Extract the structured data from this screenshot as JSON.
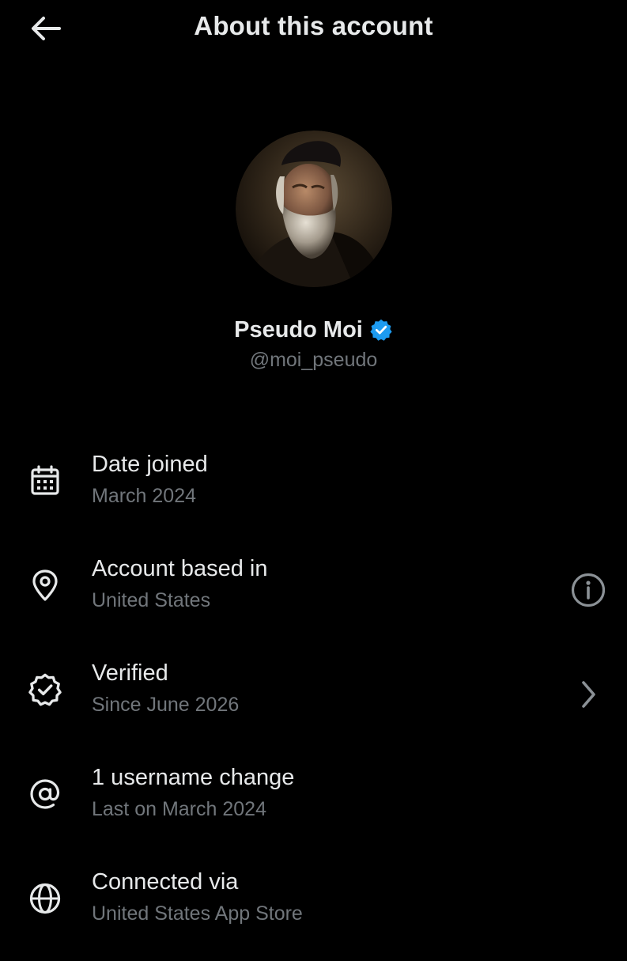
{
  "header": {
    "back_icon": "arrow-left-icon",
    "title": "About this account"
  },
  "profile": {
    "avatar": "portrait-avatar",
    "display_name": "Pseudo Moi",
    "verified_icon": "verified-badge-icon",
    "handle": "@moi_pseudo"
  },
  "rows": [
    {
      "icon": "calendar-icon",
      "label": "Date joined",
      "value": "March 2024"
    },
    {
      "icon": "location-pin-icon",
      "label": "Account based in",
      "value": "United States",
      "action_icon": "info-icon"
    },
    {
      "icon": "verified-check-icon",
      "label": "Verified",
      "value": "Since June 2026",
      "action_icon": "chevron-right-icon"
    },
    {
      "icon": "at-sign-icon",
      "label": "1 username change",
      "value": "Last on March 2024"
    },
    {
      "icon": "globe-icon",
      "label": "Connected via",
      "value": "United States App Store"
    }
  ],
  "colors": {
    "background": "#000000",
    "primary_text": "#e7e9ea",
    "secondary_text": "#71767b",
    "verified_blue": "#1d9bf0"
  }
}
